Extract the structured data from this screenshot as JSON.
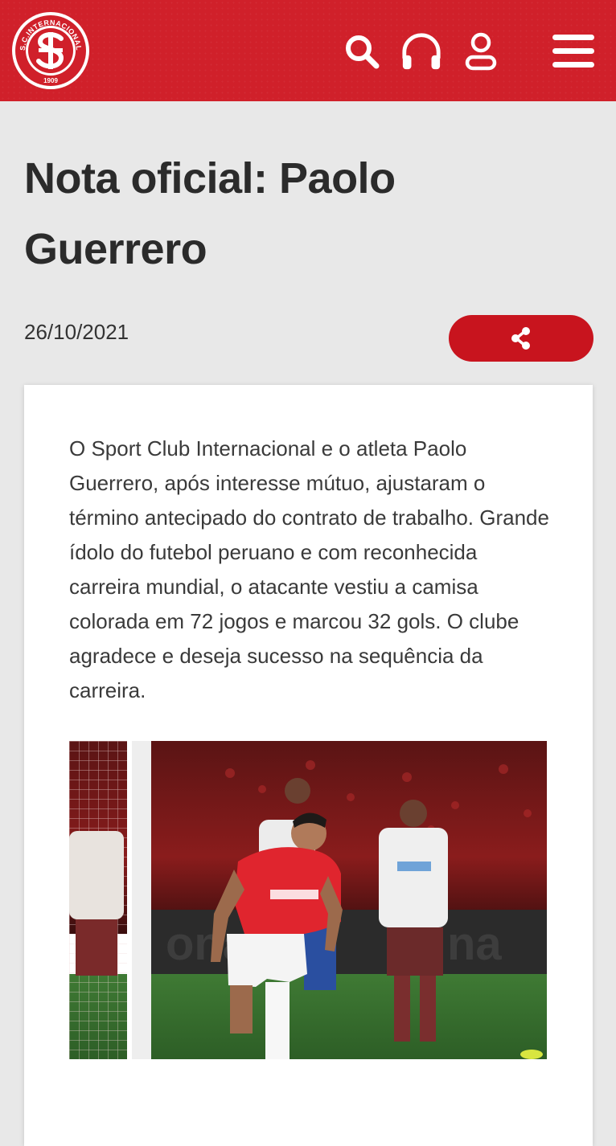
{
  "header": {
    "logo": {
      "top_text": "S.C.INTERNACIONAL",
      "year": "1909"
    },
    "icons": [
      "search-icon",
      "headphones-icon",
      "user-icon",
      "menu-icon"
    ],
    "brand_color": "#d0202a"
  },
  "article": {
    "title": "Nota oficial: Paolo Guerrero",
    "date": "26/10/2021",
    "share_icon": "share-icon",
    "body": "O Sport Club Internacional e o atleta Paolo Guerrero, após interesse mútuo, ajustaram o término antecipado do contrato de trabalho. Grande ídolo do futebol peruano e com reconhecida carreira mundial, o atacante vestiu a camisa colorada em 72 jogos e marcou 32 gols. O clube agradece e deseja sucesso na sequência da carreira."
  }
}
